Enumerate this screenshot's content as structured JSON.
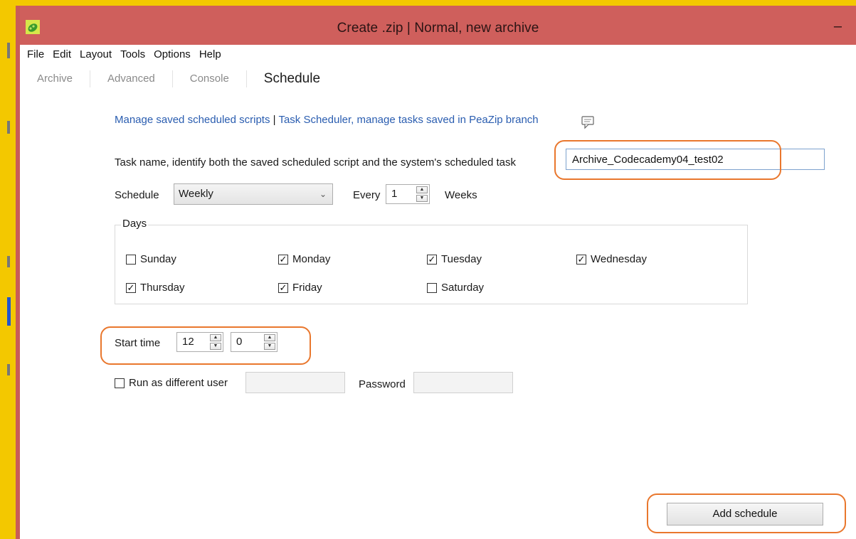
{
  "window": {
    "title": "Create .zip | Normal, new archive",
    "minimize_label": "–",
    "accent": "#cf5f5c",
    "icon": "peazip-app-icon"
  },
  "menu": [
    "File",
    "Edit",
    "Layout",
    "Tools",
    "Options",
    "Help"
  ],
  "tabs": [
    "Archive",
    "Advanced",
    "Console",
    "Schedule"
  ],
  "active_tab": "Schedule",
  "links": {
    "saved_scripts": "Manage saved scheduled scripts",
    "separator": " | ",
    "task_scheduler": "Task Scheduler, manage tasks saved in PeaZip branch"
  },
  "task_name": {
    "label": "Task name, identify both the saved scheduled script and the system's scheduled task",
    "value": "Archive_Codecademy04_test02"
  },
  "schedule": {
    "label": "Schedule",
    "value": "Weekly",
    "every_label": "Every",
    "every_value": "1",
    "unit_label": "Weeks"
  },
  "days": {
    "title": "Days",
    "items": [
      {
        "label": "Sunday",
        "checked": false
      },
      {
        "label": "Monday",
        "checked": true
      },
      {
        "label": "Tuesday",
        "checked": true
      },
      {
        "label": "Wednesday",
        "checked": true
      },
      {
        "label": "Thursday",
        "checked": true
      },
      {
        "label": "Friday",
        "checked": true
      },
      {
        "label": "Saturday",
        "checked": false
      }
    ]
  },
  "start_time": {
    "label": "Start time",
    "hour": "12",
    "minute": "0"
  },
  "run_as": {
    "label": "Run as different user",
    "checked": false,
    "user_value": "",
    "password_label": "Password",
    "password_value": ""
  },
  "add_button": "Add schedule",
  "highlight_color": "#e9772d"
}
